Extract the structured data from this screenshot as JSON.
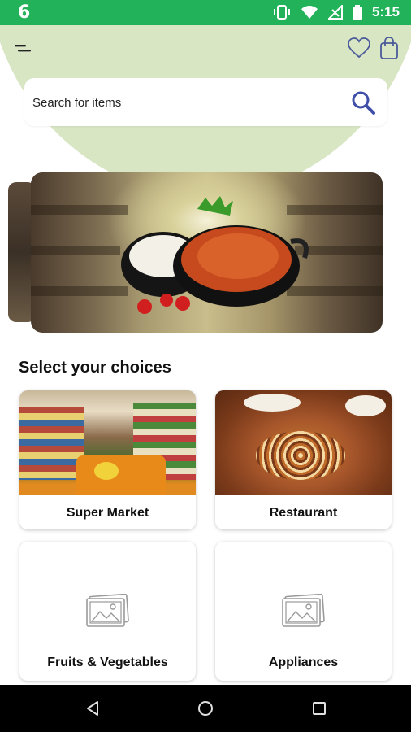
{
  "status_bar": {
    "time": "5:15",
    "background": "#22b35a"
  },
  "header": {
    "search": {
      "placeholder": "Search for items"
    },
    "accent": "#d8e6c4"
  },
  "section": {
    "title": "Select your choices"
  },
  "categories": [
    {
      "label": "Super Market"
    },
    {
      "label": "Restaurant"
    },
    {
      "label": "Fruits & Vegetables"
    },
    {
      "label": "Appliances"
    }
  ],
  "icons": {
    "menu": "menu-icon",
    "favorites": "heart-icon",
    "bag": "shopping-bag-icon",
    "search": "search-icon",
    "placeholder_image": "image-placeholder-icon"
  }
}
